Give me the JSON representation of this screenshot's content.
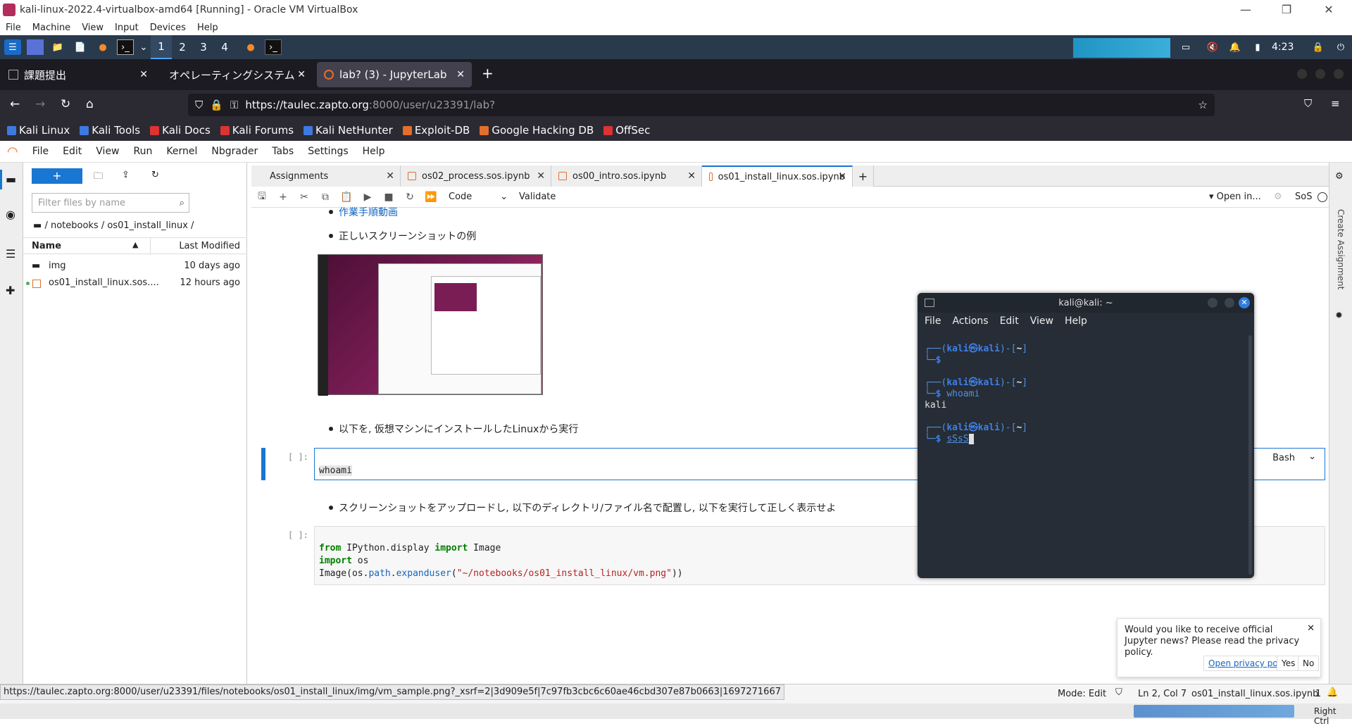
{
  "vbox": {
    "title": "kali-linux-2022.4-virtualbox-amd64 [Running] - Oracle VM VirtualBox",
    "menu": [
      "File",
      "Machine",
      "View",
      "Input",
      "Devices",
      "Help"
    ]
  },
  "panel": {
    "workspaces": [
      "1",
      "2",
      "3",
      "4"
    ],
    "time": "4:23"
  },
  "firefox": {
    "tabs": [
      {
        "label": "課題提出"
      },
      {
        "label": "オペレーティングシステム: 演"
      },
      {
        "label": "lab? (3) - JupyterLab"
      }
    ],
    "url_host": "https://taulec.zapto.org",
    "url_rest": ":8000/user/u23391/lab?",
    "bookmarks": [
      "Kali Linux",
      "Kali Tools",
      "Kali Docs",
      "Kali Forums",
      "Kali NetHunter",
      "Exploit-DB",
      "Google Hacking DB",
      "OffSec"
    ]
  },
  "jupyter": {
    "menu": [
      "File",
      "Edit",
      "View",
      "Run",
      "Kernel",
      "Nbgrader",
      "Tabs",
      "Settings",
      "Help"
    ],
    "filter_placeholder": "Filter files by name",
    "breadcrumb": "/ notebooks / os01_install_linux /",
    "col_name": "Name",
    "col_modified": "Last Modified",
    "files": [
      {
        "name": "img",
        "modified": "10 days ago"
      },
      {
        "name": "os01_install_linux.sos....",
        "modified": "12 hours ago"
      }
    ],
    "tabs": [
      "Assignments",
      "os02_process.sos.ipynb",
      "os00_intro.sos.ipynb",
      "os01_install_linux.sos.ipynb"
    ],
    "celltype": "Code",
    "validate": "Validate",
    "open_in": "Open in...",
    "kernel": "SoS",
    "right_label": "Create Assignment",
    "cells": {
      "link": "作業手順動画",
      "b1": "正しいスクリーンショットの例",
      "b2": "以下を, 仮想マシンにインストールしたLinuxから実行",
      "prompt1": "[ ]:",
      "code1": "whoami",
      "lang": "Bash",
      "b3": "スクリーンショットをアップロードし, 以下のディレクトリ/ファイル名で配置し, 以下を実行して正しく表示せよ",
      "prompt2": "[ ]:",
      "code2": {
        "l1_from": "from",
        "l1_mid": " IPython.display ",
        "l1_import": "import",
        "l1_end": " Image",
        "l2_import": "import",
        "l2_end": " os",
        "l3_a": "Image(os.",
        "l3_b": "path",
        "l3_c": ".",
        "l3_d": "expanduser",
        "l3_e": "(",
        "l3_f": "\"~/notebooks/os01_install_linux/vm.png\"",
        "l3_g": "))"
      }
    }
  },
  "terminal": {
    "title": "kali@kali: ~",
    "menu": [
      "File",
      "Actions",
      "Edit",
      "View",
      "Help"
    ],
    "user": "kali",
    "host": "kali",
    "dir": "~",
    "cmd1": "whoami",
    "out1": "kali",
    "cmd2": "sSsS"
  },
  "notification": {
    "text": "Would you like to receive official Jupyter news? Please read the privacy policy.",
    "link": "Open privacy policy",
    "yes": "Yes",
    "no": "No"
  },
  "status": {
    "hover_url": "https://taulec.zapto.org:8000/user/u23391/files/notebooks/os01_install_linux/img/vm_sample.png?_xsrf=2|3d909e5f|7c97fb3cbc6c60ae46cbd307e87b0663|1697271667",
    "mode": "Mode: Edit",
    "position": "Ln 2, Col 7",
    "file": "os01_install_linux.sos.ipynb",
    "count": "1"
  },
  "vbstatus": {
    "hostkey": "Right Ctrl"
  }
}
